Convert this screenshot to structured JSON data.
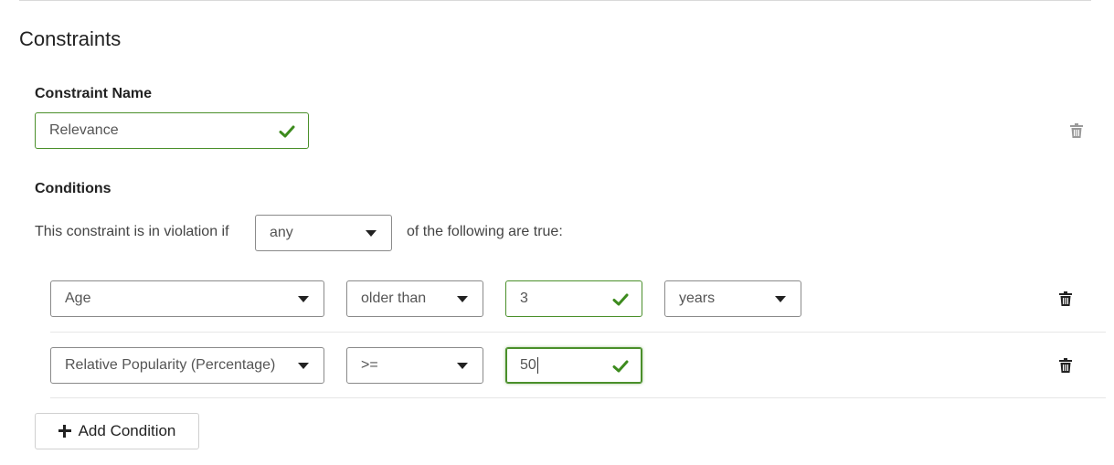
{
  "section": {
    "title": "Constraints"
  },
  "constraint_name": {
    "label": "Constraint Name",
    "value": "Relevance"
  },
  "conditions": {
    "label": "Conditions",
    "prefix_text": "This constraint is in violation if",
    "match_mode": "any",
    "suffix_text": "of the following are true:",
    "rows": [
      {
        "field": "Age",
        "operator": "older than",
        "value": "3",
        "unit": "years"
      },
      {
        "field": "Relative Popularity (Percentage)",
        "operator": ">=",
        "value": "50"
      }
    ]
  },
  "add_condition": {
    "label": "Add Condition"
  },
  "icons": {
    "valid": "check-icon",
    "delete": "trash-icon",
    "dropdown": "chevron-down-icon",
    "add": "plus-icon"
  },
  "colors": {
    "valid_border": "#4a8f2a",
    "check": "#3d8b1e",
    "trash_dark": "#222222",
    "trash_light": "#9a9a9a"
  }
}
